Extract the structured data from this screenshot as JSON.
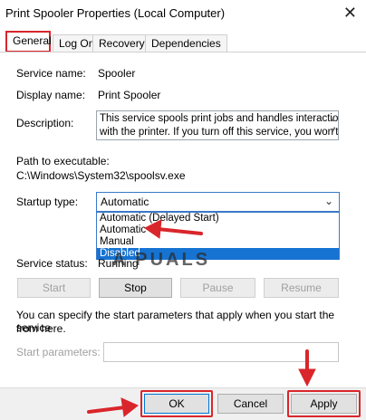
{
  "window": {
    "title": "Print Spooler Properties (Local Computer)",
    "close_glyph": "✕"
  },
  "tabs": [
    {
      "label": "General"
    },
    {
      "label": "Log On"
    },
    {
      "label": "Recovery"
    },
    {
      "label": "Dependencies"
    }
  ],
  "general": {
    "service_name_label": "Service name:",
    "service_name": "Spooler",
    "display_name_label": "Display name:",
    "display_name": "Print Spooler",
    "description_label": "Description:",
    "description_line1": "This service spools print jobs and handles interaction",
    "description_line2": "with the printer.  If you turn off this service, you won't",
    "path_label": "Path to executable:",
    "path": "C:\\Windows\\System32\\spoolsv.exe",
    "startup_type_label": "Startup type:",
    "startup_selected": "Automatic",
    "startup_options": [
      "Automatic (Delayed Start)",
      "Automatic",
      "Manual",
      "Disabled"
    ],
    "service_status_label": "Service status:",
    "service_status": "Running",
    "start_button": "Start",
    "stop_button": "Stop",
    "pause_button": "Pause",
    "resume_button": "Resume",
    "help_text_line1": "You can specify the start parameters that apply when you start the service",
    "help_text_line2": "from here.",
    "start_params_label": "Start parameters:",
    "start_params_value": ""
  },
  "footer": {
    "ok": "OK",
    "cancel": "Cancel",
    "apply": "Apply"
  },
  "watermark": "A  PUALS",
  "colors": {
    "annotation_red": "#d9262b",
    "highlight_blue": "#1673d2",
    "focus_blue": "#3a79c8"
  }
}
